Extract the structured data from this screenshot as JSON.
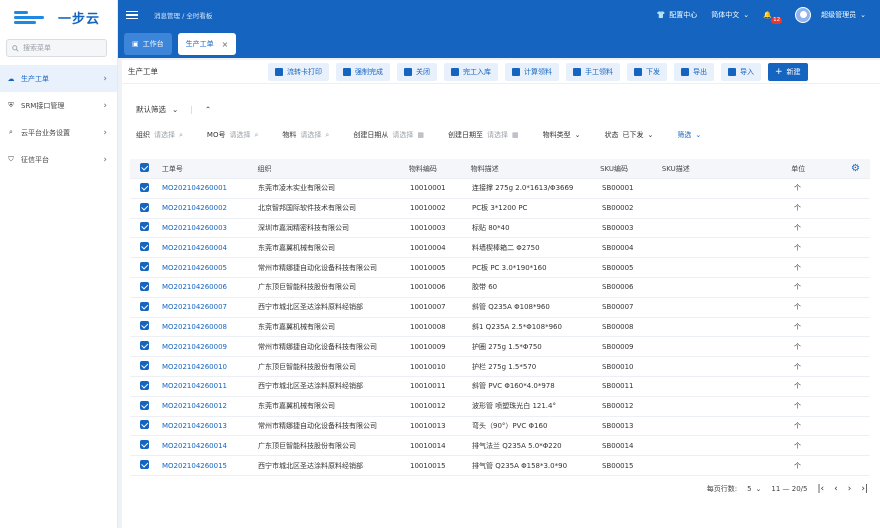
{
  "brand": {
    "name": "一步云"
  },
  "sidebar": {
    "search_placeholder": "搜索菜单",
    "items": [
      {
        "label": "生产工单",
        "icon": "cloud-icon",
        "active": true
      },
      {
        "label": "SRM接口管理",
        "icon": "shield-icon",
        "active": false
      },
      {
        "label": "云平台业务设置",
        "icon": "search-cloud-icon",
        "active": false
      },
      {
        "label": "征信平台",
        "icon": "shield-check-icon",
        "active": false
      }
    ]
  },
  "topbar": {
    "breadcrumb": "消息管理 / 全时看板",
    "config_center": "配置中心",
    "language": "简体中文",
    "notification_count": "12",
    "user": "超级管理员"
  },
  "tabs": [
    {
      "label": "工作台"
    },
    {
      "label": "生产工单"
    }
  ],
  "toolbar": {
    "title": "生产工单",
    "buttons": [
      "流转卡打印",
      "强制完成",
      "关闭",
      "完工入库",
      "计算领料",
      "手工领料",
      "下发",
      "导出",
      "导入"
    ],
    "new_label": "新建"
  },
  "filter": {
    "default_label": "默认筛选",
    "fields": [
      {
        "label": "组织",
        "placeholder": "请选择"
      },
      {
        "label": "MO号",
        "placeholder": "请选择"
      },
      {
        "label": "物料",
        "placeholder": "请选择"
      },
      {
        "label": "创建日期从",
        "placeholder": "请选择"
      },
      {
        "label": "创建日期至",
        "placeholder": "请选择"
      }
    ],
    "material_type": "物料类型",
    "status_label": "状态",
    "status_value": "已下发",
    "filter_link": "筛选"
  },
  "table": {
    "columns": [
      "工单号",
      "组织",
      "物料编码",
      "物料描述",
      "SKU编码",
      "SKU描述",
      "单位"
    ],
    "rows": [
      [
        "MO202104260001",
        "东莞市凌木实业有限公司",
        "10010001",
        "连接撑 275g 2.0*1613/Φ3669",
        "SB00001",
        "",
        "个"
      ],
      [
        "MO202104260002",
        "北京智邦国际软件技术有限公司",
        "10010002",
        "PC板 3*1200 PC",
        "SB00002",
        "",
        "个"
      ],
      [
        "MO202104260003",
        "深圳市嘉润精密科技有限公司",
        "10010003",
        "标贴 80*40",
        "SB00003",
        "",
        "个"
      ],
      [
        "MO202104260004",
        "东莞市嘉翼机械有限公司",
        "10010004",
        "料墙楔棒箱二 Φ2750",
        "SB00004",
        "",
        "个"
      ],
      [
        "MO202104260005",
        "常州市精娜捷自动化设备科技有限公司",
        "10010005",
        "PC板 PC 3.0*190*160",
        "SB00005",
        "",
        "个"
      ],
      [
        "MO202104260006",
        "广东顶巨智能科技股份有限公司",
        "10010006",
        "胶带 60",
        "SB00006",
        "",
        "个"
      ],
      [
        "MO202104260007",
        "西宁市城北区圣达涂料原料经销部",
        "10010007",
        "斜管 Q235A Φ108*960",
        "SB00007",
        "",
        "个"
      ],
      [
        "MO202104260008",
        "东莞市嘉翼机械有限公司",
        "10010008",
        "斜1 Q235A 2.5*Φ108*960",
        "SB00008",
        "",
        "个"
      ],
      [
        "MO202104260009",
        "常州市精娜捷自动化设备科技有限公司",
        "10010009",
        "护圈 275g 1.5*Φ750",
        "SB00009",
        "",
        "个"
      ],
      [
        "MO202104260010",
        "广东顶巨智能科技股份有限公司",
        "10010010",
        "护栏 275g 1.5*570",
        "SB00010",
        "",
        "个"
      ],
      [
        "MO202104260011",
        "西宁市城北区圣达涂料原料经销部",
        "10010011",
        "斜管 PVC Φ160*4.0*978",
        "SB00011",
        "",
        "个"
      ],
      [
        "MO202104260012",
        "东莞市嘉翼机械有限公司",
        "10010012",
        "波形管 喷塑珠光白 121.4°",
        "SB00012",
        "",
        "个"
      ],
      [
        "MO202104260013",
        "常州市精娜捷自动化设备科技有限公司",
        "10010013",
        "弯头（90°）PVC Φ160",
        "SB00013",
        "",
        "个"
      ],
      [
        "MO202104260014",
        "广东顶巨智能科技股份有限公司",
        "10010014",
        "排气法兰 Q235A 5.0*Φ220",
        "SB00014",
        "",
        "个"
      ],
      [
        "MO202104260015",
        "西宁市城北区圣达涂料原料经销部",
        "10010015",
        "排气管 Q235A Φ158*3.0*90",
        "SB00015",
        "",
        "个"
      ]
    ]
  },
  "pager": {
    "per_page_label": "每页行数:",
    "per_page": "5",
    "range": "11 — 20/5"
  },
  "colors": {
    "primary": "#1565c0",
    "light": "#e8f0fb",
    "badge": "#e53935"
  }
}
